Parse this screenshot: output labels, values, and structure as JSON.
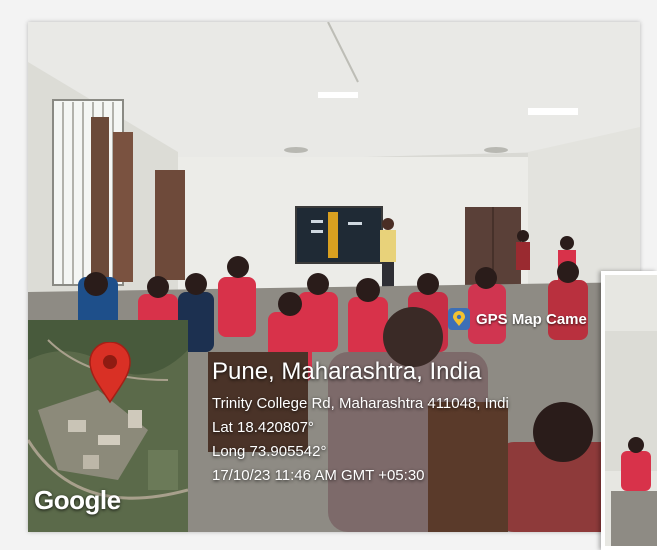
{
  "overlay": {
    "app_name": "GPS Map Came",
    "map_brand": "Google",
    "city": "Pune, Maharashtra, India",
    "address": "Trinity College Rd, Maharashtra 411048, Indi",
    "latitude": "Lat 18.420807°",
    "longitude": "Long 73.905542°",
    "timestamp": "17/10/23 11:46 AM GMT +05:30"
  },
  "icons": {
    "map_pin": "location-pin-icon",
    "app_logo": "gps-map-camera-icon"
  },
  "colors": {
    "pin": "#d93025",
    "shirts": "#d8324a",
    "screen": "#1f2a35"
  }
}
